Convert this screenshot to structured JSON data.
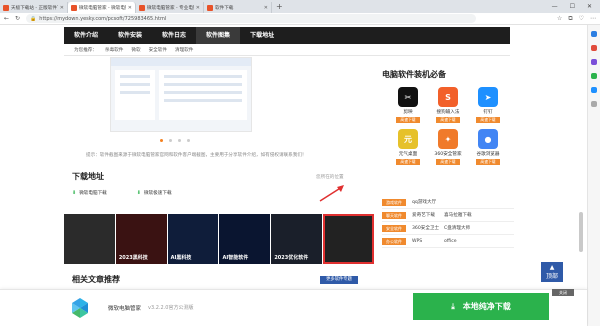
{
  "browser": {
    "tabs": [
      {
        "label": "天极下载站 - 正版软件下载平台",
        "active": false
      },
      {
        "label": "微软电脑管家 - 微软电脑管家下载",
        "active": true
      },
      {
        "label": "微软电脑管家 - 专业电脑管家下载",
        "active": false
      },
      {
        "label": "软件下载",
        "active": false
      }
    ],
    "url": "https://mydown.yesky.com/pcsoft/725983465.html"
  },
  "site_nav": {
    "items": [
      "软件介绍",
      "软件安装",
      "软件日志",
      "软件图集",
      "下载地址"
    ],
    "active_index": 3
  },
  "subnav": {
    "label": "为您推荐：",
    "items": [
      "杀毒软件",
      "微软",
      "安全软件",
      "清理软件"
    ]
  },
  "carousel": {
    "dots": 4,
    "active": 0
  },
  "tip": "提示：软件截图来源于微软电脑管家官网和软件客户端截图，主要用于分享软件介绍，如有侵权请联系我们！",
  "download": {
    "title": "下载地址",
    "report": "您所在的位置",
    "links": [
      "微软电脑下载",
      "微软极速下载"
    ]
  },
  "thumbs": [
    {
      "text": "",
      "highlight": false
    },
    {
      "text": "2023黑科技",
      "highlight": false
    },
    {
      "text": "AI黑科技",
      "highlight": false
    },
    {
      "text": "AI智能软件",
      "highlight": false
    },
    {
      "text": "2023优化软件",
      "highlight": false
    },
    {
      "text": "",
      "highlight": true
    }
  ],
  "related": {
    "title": "相关文章推荐",
    "more": "更多软件专题"
  },
  "sidebar": {
    "title": "电脑软件装机必备",
    "apps": [
      {
        "name": "剪映",
        "btn": "高速下载",
        "color": "#111111",
        "glyph": "✂"
      },
      {
        "name": "搜狗输入法",
        "btn": "高速下载",
        "color": "#f2602a",
        "glyph": "S"
      },
      {
        "name": "钉钉",
        "btn": "高速下载",
        "color": "#1e90ff",
        "glyph": "➤"
      },
      {
        "name": "元气桌面",
        "btn": "高速下载",
        "color": "#e6c12a",
        "glyph": "元"
      },
      {
        "name": "360安全管家",
        "btn": "高速下载",
        "color": "#f07a2a",
        "glyph": "✦"
      },
      {
        "name": "谷歌浏览器",
        "btn": "高速下载",
        "color": "#4285f4",
        "glyph": "●"
      }
    ],
    "categories": [
      {
        "tag": "游戏软件",
        "a": "qq游戏大厅",
        "b": ""
      },
      {
        "tag": "聊天软件",
        "a": "爱奇艺下载",
        "b": "喜马拉雅下载"
      },
      {
        "tag": "安全软件",
        "a": "360安全卫士",
        "b": "C盘清理大师"
      },
      {
        "tag": "办公软件",
        "a": "WPS",
        "b": "office"
      }
    ]
  },
  "top_button": "顶部",
  "download_bar": {
    "name": "微软电脑管家",
    "version": "v3.2.2.0官方公测版",
    "button": "本地纯净下载",
    "close": "关闭"
  }
}
